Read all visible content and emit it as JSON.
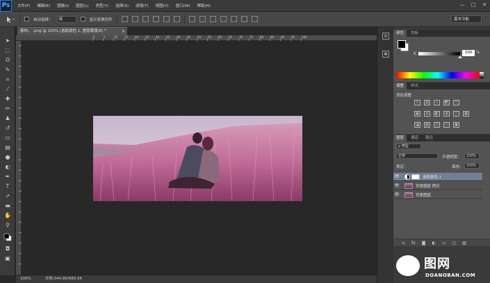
{
  "app": {
    "logo": "Ps",
    "menu": [
      "文件(F)",
      "编辑(E)",
      "图像(I)",
      "图层(L)",
      "类型(Y)",
      "选择(S)",
      "滤镜(T)",
      "视图(V)",
      "窗口(W)",
      "帮助(H)"
    ],
    "window_controls": [
      "—",
      "□",
      "✕"
    ]
  },
  "options": {
    "auto_select_label": "自动选择：",
    "auto_select_value": "组",
    "show_transform_label": "显示变换控件",
    "workspace": "基本功能"
  },
  "document": {
    "tab_title": "素材。 .png @ 100% (选取颜色 1, 图层蒙版/8) *",
    "tab_close": "×",
    "zoom": "100%",
    "doc_size": "文档:344.8K/689.6K"
  },
  "ruler": {
    "h_labels": [
      "0",
      "5",
      "10",
      "15",
      "20",
      "25",
      "30",
      "35",
      "40",
      "45",
      "50",
      "55",
      "60",
      "65",
      "70",
      "75",
      "80",
      "85",
      "90",
      "95",
      "100"
    ]
  },
  "color_panel": {
    "tabs": [
      "颜色",
      "色板"
    ],
    "channel": "K",
    "value": "100",
    "unit": "%"
  },
  "adjustments_panel": {
    "tabs": [
      "调整",
      "样式"
    ],
    "title": "添加调整"
  },
  "layers_panel": {
    "tabs": [
      "图层",
      "通道",
      "路径"
    ],
    "kind_filter": "ρ 类型",
    "blend_mode": "正常",
    "opacity_label": "不透明度：",
    "opacity_value": "100%",
    "lock_label": "锁定：",
    "fill_label": "填充：",
    "fill_value": "100%",
    "layers": [
      {
        "name": "选取颜色 1",
        "type": "adjustment",
        "selected": true
      },
      {
        "name": "背景图层 拷贝",
        "type": "image",
        "selected": false
      },
      {
        "name": "背景图层",
        "type": "image",
        "selected": false
      }
    ],
    "footer_icons": [
      "link-icon",
      "fx-icon",
      "mask-icon",
      "adjustment-icon",
      "folder-icon",
      "new-layer-icon",
      "trash-icon"
    ]
  },
  "watermark": {
    "text": "图网",
    "url": "DOANOBAN.COM"
  },
  "colors": {
    "selected_layer": "#6f7f94",
    "photo_tint": "#b96e9c"
  }
}
